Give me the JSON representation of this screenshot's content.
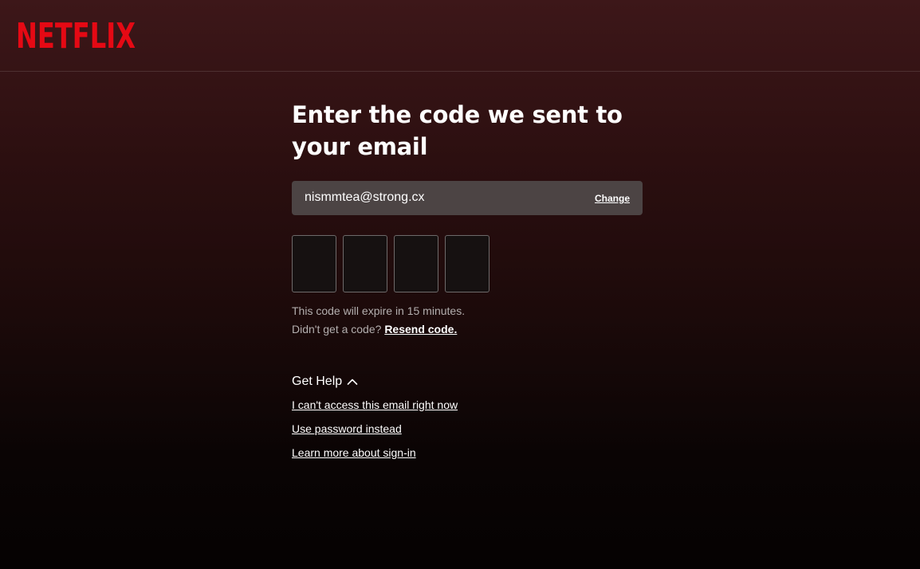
{
  "brand": {
    "logo_text": "NETFLIX",
    "color": "#e50914"
  },
  "main": {
    "title": "Enter the code we sent to your email",
    "email": "nismmtea@strong.cx",
    "change_label": "Change",
    "code_boxes": [
      "",
      "",
      "",
      ""
    ],
    "expire_text": "This code will expire in 15 minutes.",
    "no_code_text": "Didn't get a code?",
    "resend_label": "Resend code."
  },
  "help": {
    "toggle_label": "Get Help",
    "toggle_icon": "chevron-up-icon",
    "links": [
      "I can't access this email right now",
      "Use password instead",
      "Learn more about sign-in"
    ]
  }
}
